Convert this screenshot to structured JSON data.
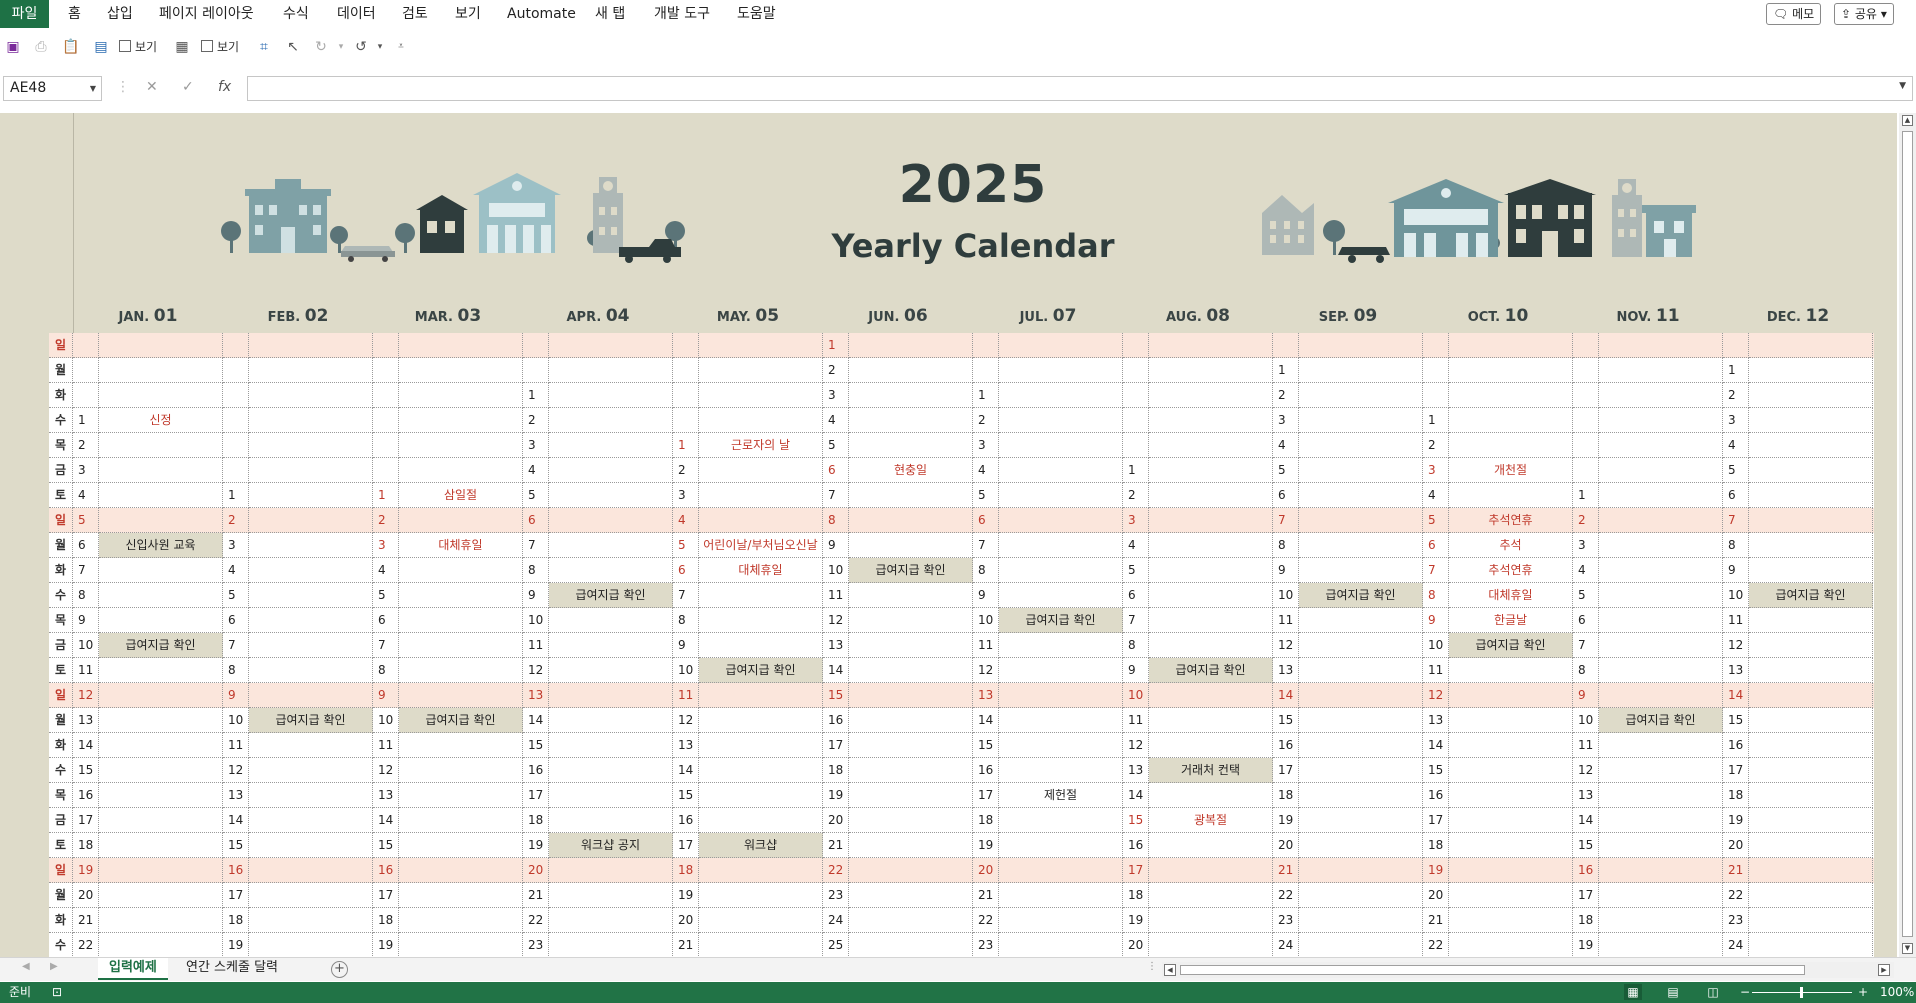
{
  "ribbon": {
    "tabs": [
      "파일",
      "홈",
      "삽입",
      "페이지 레이아웃",
      "수식",
      "데이터",
      "검토",
      "보기",
      "Automate",
      "새 탭",
      "개발 도구",
      "도움말"
    ],
    "memo_button": "메모",
    "share_button": "공유"
  },
  "qat": {
    "view_label_1": "보기",
    "view_label_2": "보기"
  },
  "formula_bar": {
    "name_box": "AE48",
    "formula": ""
  },
  "calendar": {
    "year": "2025",
    "subtitle": "Yearly Calendar",
    "months": [
      {
        "abbr": "JAN.",
        "num": "01"
      },
      {
        "abbr": "FEB.",
        "num": "02"
      },
      {
        "abbr": "MAR.",
        "num": "03"
      },
      {
        "abbr": "APR.",
        "num": "04"
      },
      {
        "abbr": "MAY.",
        "num": "05"
      },
      {
        "abbr": "JUN.",
        "num": "06"
      },
      {
        "abbr": "JUL.",
        "num": "07"
      },
      {
        "abbr": "AUG.",
        "num": "08"
      },
      {
        "abbr": "SEP.",
        "num": "09"
      },
      {
        "abbr": "OCT.",
        "num": "10"
      },
      {
        "abbr": "NOV.",
        "num": "11"
      },
      {
        "abbr": "DEC.",
        "num": "12"
      }
    ],
    "weekdays": [
      "일",
      "월",
      "화",
      "수",
      "목",
      "금",
      "토",
      "일",
      "월",
      "화",
      "수",
      "목",
      "금",
      "토",
      "일",
      "월",
      "화",
      "수",
      "목",
      "금",
      "토",
      "일",
      "월",
      "화",
      "수"
    ],
    "first_weekday_index": [
      3,
      6,
      6,
      2,
      4,
      0,
      2,
      5,
      1,
      3,
      6,
      1
    ],
    "holiday_days": [
      [],
      [],
      [
        1,
        3
      ],
      [],
      [
        1,
        5,
        6
      ],
      [
        6
      ],
      [],
      [
        15
      ],
      [],
      [
        3,
        5,
        6,
        7,
        8,
        9
      ],
      [],
      []
    ],
    "notes": [
      [
        {
          "day": 1,
          "text": "신정",
          "red": true
        },
        {
          "day": 6,
          "text": "신입사원 교육",
          "ev": true
        },
        {
          "day": 10,
          "text": "급여지급 확인",
          "ev": true
        }
      ],
      [
        {
          "day": 10,
          "text": "급여지급 확인",
          "ev": true
        }
      ],
      [
        {
          "day": 1,
          "text": "삼일절",
          "red": true
        },
        {
          "day": 3,
          "text": "대체휴일",
          "red": true
        },
        {
          "day": 10,
          "text": "급여지급 확인",
          "ev": true
        }
      ],
      [
        {
          "day": 9,
          "text": "급여지급 확인",
          "ev": true
        },
        {
          "day": 19,
          "text": "워크샵 공지",
          "ev": true
        }
      ],
      [
        {
          "day": 1,
          "text": "근로자의 날",
          "red": true
        },
        {
          "day": 5,
          "text": "어린이날/부처님오신날",
          "red": true
        },
        {
          "day": 6,
          "text": "대체휴일",
          "red": true
        },
        {
          "day": 10,
          "text": "급여지급 확인",
          "ev": true
        },
        {
          "day": 17,
          "text": "워크샵",
          "ev": true
        }
      ],
      [
        {
          "day": 6,
          "text": "현충일",
          "red": true
        },
        {
          "day": 10,
          "text": "급여지급 확인",
          "ev": true
        }
      ],
      [
        {
          "day": 10,
          "text": "급여지급 확인",
          "ev": true
        },
        {
          "day": 17,
          "text": "제헌절"
        }
      ],
      [
        {
          "day": 9,
          "text": "급여지급 확인",
          "ev": true
        },
        {
          "day": 13,
          "text": "거래처 컨택",
          "ev": true
        },
        {
          "day": 15,
          "text": "광복절",
          "red": true
        }
      ],
      [
        {
          "day": 10,
          "text": "급여지급 확인",
          "ev": true
        }
      ],
      [
        {
          "day": 3,
          "text": "개천절",
          "red": true
        },
        {
          "day": 5,
          "text": "추석연휴",
          "red": true
        },
        {
          "day": 6,
          "text": "추석",
          "red": true
        },
        {
          "day": 7,
          "text": "추석연휴",
          "red": true
        },
        {
          "day": 8,
          "text": "대체휴일",
          "red": true
        },
        {
          "day": 9,
          "text": "한글날",
          "red": true
        },
        {
          "day": 10,
          "text": "급여지급 확인",
          "ev": true
        }
      ],
      [
        {
          "day": 10,
          "text": "급여지급 확인",
          "ev": true
        }
      ],
      [
        {
          "day": 10,
          "text": "급여지급 확인",
          "ev": true
        }
      ]
    ]
  },
  "sheet_tabs": [
    "입력예제",
    "연간 스케줄 달력"
  ],
  "status": {
    "ready": "준비",
    "zoom": "100%"
  },
  "colors": {
    "excel_green": "#1e7145",
    "banner_bg": "#dedbc9",
    "sunday_row": "#fbe6dc",
    "holiday_red": "#c0392b",
    "title_dark": "#2f3d3d"
  }
}
